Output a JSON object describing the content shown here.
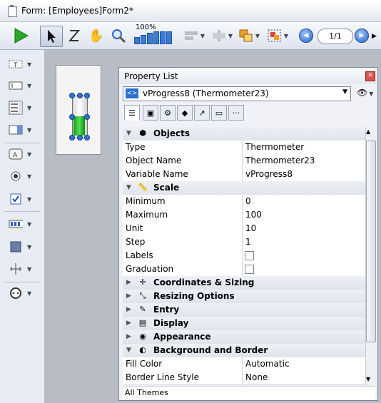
{
  "window": {
    "title": "Form: [Employees]Form2*"
  },
  "toolbar": {
    "zoom_label": "100%",
    "page_indicator": "1/1"
  },
  "property_list": {
    "title": "Property List",
    "object_selector": "vProgress8 (Thermometer23)",
    "rows": [
      {
        "kind": "category",
        "label": "Objects",
        "expanded": true,
        "icon": "cube-icon"
      },
      {
        "kind": "prop",
        "key": "Type",
        "value": "Thermometer"
      },
      {
        "kind": "prop",
        "key": "Object Name",
        "value": "Thermometer23"
      },
      {
        "kind": "prop",
        "key": "Variable Name",
        "value": "vProgress8"
      },
      {
        "kind": "category",
        "label": "Scale",
        "expanded": true,
        "icon": "ruler-icon"
      },
      {
        "kind": "prop",
        "key": "Minimum",
        "value": "0"
      },
      {
        "kind": "prop",
        "key": "Maximum",
        "value": "100"
      },
      {
        "kind": "prop",
        "key": "Unit",
        "value": "10"
      },
      {
        "kind": "prop",
        "key": "Step",
        "value": "1"
      },
      {
        "kind": "check",
        "key": "Labels",
        "checked": false
      },
      {
        "kind": "check",
        "key": "Graduation",
        "checked": false
      },
      {
        "kind": "category",
        "label": "Coordinates & Sizing",
        "expanded": false,
        "icon": "coordinates-icon"
      },
      {
        "kind": "category",
        "label": "Resizing Options",
        "expanded": false,
        "icon": "resize-icon"
      },
      {
        "kind": "category",
        "label": "Entry",
        "expanded": false,
        "icon": "entry-icon"
      },
      {
        "kind": "category",
        "label": "Display",
        "expanded": false,
        "icon": "display-icon"
      },
      {
        "kind": "category",
        "label": "Appearance",
        "expanded": false,
        "icon": "eye-icon"
      },
      {
        "kind": "category",
        "label": "Background and Border",
        "expanded": true,
        "icon": "paint-icon"
      },
      {
        "kind": "prop",
        "key": "Fill Color",
        "value": "Automatic"
      },
      {
        "kind": "prop",
        "key": "Border Line Style",
        "value": "None"
      }
    ],
    "footer": "All Themes"
  }
}
